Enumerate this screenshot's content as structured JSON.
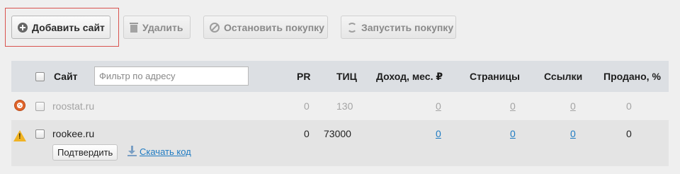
{
  "toolbar": {
    "add_label": "Добавить сайт",
    "delete_label": "Удалить",
    "stop_label": "Остановить покупку",
    "start_label": "Запустить покупку"
  },
  "table": {
    "headers": {
      "site": "Сайт",
      "filter_placeholder": "Фильтр по адресу",
      "pr": "PR",
      "tic": "ТИЦ",
      "income": "Доход, мес. ₽",
      "pages": "Страницы",
      "links": "Ссылки",
      "sold": "Продано, %"
    },
    "rows": [
      {
        "status": "stopped",
        "status_icon": "stop-icon",
        "site": "roostat.ru",
        "pr": "0",
        "tic": "130",
        "income": "0",
        "pages": "0",
        "links": "0",
        "sold": "0"
      },
      {
        "status": "warning",
        "status_icon": "warning-icon",
        "site": "rookee.ru",
        "pr": "0",
        "tic": "73000",
        "income": "0",
        "pages": "0",
        "links": "0",
        "sold": "0",
        "confirm_label": "Подтвердить",
        "download_label": "Скачать код"
      }
    ]
  },
  "colors": {
    "page_bg": "#efefef",
    "header_bg": "#dcdfe3",
    "link": "#1f7bc2",
    "highlight_border": "#d9534f",
    "stop_icon": "#e0642a",
    "warning_icon": "#f0b323"
  }
}
